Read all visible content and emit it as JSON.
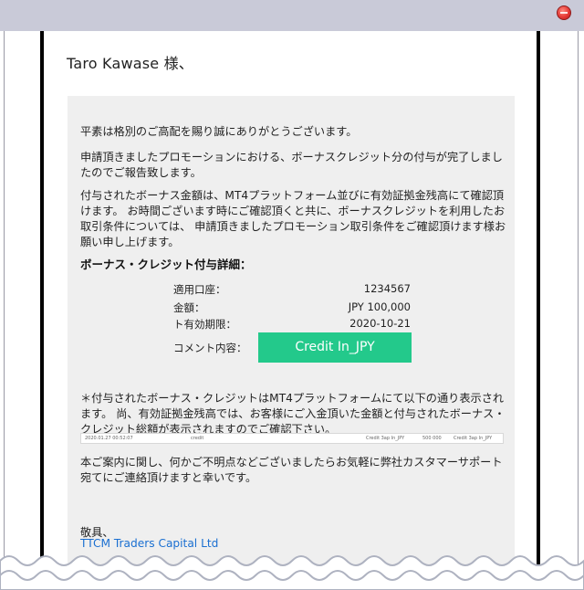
{
  "email": {
    "greeting": "Taro Kawase 様、",
    "paragraphs": [
      "平素は格別のご高配を賜り誠にありがとうございます。",
      "申請頂きましたプロモーションにおける、ボーナスクレジット分の付与が完了しましたのでご報告致します。",
      "付与されたボーナス金額は、MT4プラットフォーム並びに有効証拠金残高にて確認頂けます。 お時間ございます時にご確認頂くと共に、ボーナスクレジットを利用したお取引条件については、 申請頂きましたプロモーション取引条件をご確認頂けます様お願い申し上げます。"
    ],
    "details_title": "ボーナス・クレジット付与詳細：",
    "details": {
      "account_label": "適用口座：",
      "account_value": "1234567",
      "amount_label": "金額：",
      "amount_value": "JPY 100,000",
      "expiry_label": "ト有効期限：",
      "expiry_value": "2020-10-21",
      "comment_label": "コメント内容：",
      "comment_value": "Credit In_JPY"
    },
    "note": "＊付与されたボーナス・クレジットはMT4プラットフォームにて以下の通り表示されます。 尚、有効証拠金残高では、お客様にご入金頂いた金額と付与されたボーナス・クレジット総額が表示されますのでご確認下さい。",
    "mt4_strip": {
      "date": "2020.01.27 00:52:07",
      "credit": "credit",
      "comment": "Credit 3ap In_JPY",
      "amount": "500 000",
      "comment2": "Credit 3ap In_JPY"
    },
    "support": "本ご案内に関し、何かご不明点などございましたらお気軽に弊社カスタマーサポート宛てにご連絡頂けますと幸いです。",
    "signoff": "敬具、",
    "company": "TTCM Traders Capital Ltd"
  },
  "colors": {
    "badge": "#23c98b",
    "link": "#1a6fd1",
    "titlebar": "#c9cad8",
    "panel": "#efefef",
    "close": "#e53935"
  },
  "icons": {
    "close": "close-icon"
  }
}
